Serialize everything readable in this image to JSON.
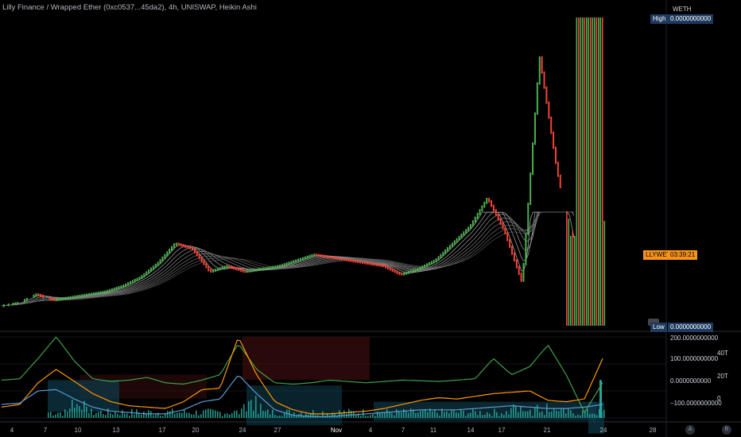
{
  "header": {
    "title": "Lilly Finance / Wrapped Ether (0xc0537...45da2), 4h, UNISWAP, Heikin Ashi"
  },
  "price_axis": {
    "currency": "WETH",
    "high_label": "High",
    "high_value": "0.0000000000",
    "low_label": "Low",
    "low_value": "0.0000000000",
    "symbol_tag": "LLYWETH",
    "countdown": "03:39:21"
  },
  "oscillator_axis": {
    "labels": [
      "200.0000000000",
      "100.0000000000",
      "0.0000000000",
      "−100.0000000000"
    ],
    "volume_labels": [
      "40T",
      "20T",
      "0"
    ]
  },
  "time_axis": {
    "ticks": [
      "4",
      "7",
      "10",
      "13",
      "17",
      "20",
      "24",
      "27",
      "Nov",
      "4",
      "7",
      "11",
      "14",
      "17",
      "21",
      "24",
      "28"
    ],
    "highlight": "Nov"
  },
  "footer_buttons": {
    "auto": "A",
    "log": "B"
  },
  "colors": {
    "bull": "#4caf50",
    "bear": "#f44336",
    "orange": "#ff9800",
    "tag_dark": "#1e3a5f",
    "green_line": "#43a047",
    "red_line": "#e53935",
    "blue_line": "#5b9bd5",
    "histogram": "#26a69a"
  },
  "chart_data": [
    {
      "type": "candlestick",
      "style": "Heikin Ashi",
      "interval": "4h",
      "exchange": "UNISWAP",
      "x_labels": [
        "4",
        "7",
        "10",
        "13",
        "17",
        "20",
        "24",
        "27",
        "Nov",
        "4",
        "7",
        "11",
        "14",
        "17",
        "21",
        "24",
        "28"
      ],
      "price_trend_relative": [
        0.02,
        0.03,
        0.06,
        0.04,
        0.05,
        0.06,
        0.07,
        0.09,
        0.12,
        0.17,
        0.24,
        0.22,
        0.14,
        0.16,
        0.14,
        0.15,
        0.16,
        0.18,
        0.2,
        0.19,
        0.18,
        0.17,
        0.16,
        0.13,
        0.15,
        0.18,
        0.24,
        0.3,
        0.4,
        0.28,
        0.1,
        0.9,
        0.5,
        0.2
      ]
    },
    {
      "type": "line",
      "name": "oscillator",
      "ylim": [
        -100,
        200
      ],
      "series": [
        {
          "color": "#43a047",
          "values": [
            40,
            45,
            120,
            200,
            110,
            45,
            35,
            40,
            50,
            30,
            25,
            40,
            60,
            175,
            80,
            30,
            25,
            30,
            40,
            35,
            30,
            35,
            40,
            38,
            35,
            40,
            45,
            120,
            60,
            90,
            170,
            60,
            -80,
            30
          ]
        },
        {
          "color": "#ff9800",
          "values": [
            -60,
            -50,
            30,
            80,
            35,
            -10,
            -40,
            -55,
            -60,
            -65,
            -40,
            5,
            10,
            200,
            60,
            -40,
            -70,
            -85,
            -85,
            -80,
            -75,
            -65,
            -50,
            -35,
            -25,
            -30,
            -20,
            -10,
            -5,
            0,
            -35,
            -40,
            -30,
            120
          ]
        },
        {
          "color": "#5b9bd5",
          "values": [
            -50,
            -45,
            0,
            5,
            -30,
            -60,
            -75,
            -80,
            -85,
            -85,
            -70,
            -40,
            -30,
            60,
            -10,
            -70,
            -90,
            -95,
            -95,
            -90,
            -85,
            -80,
            -75,
            -70,
            -70,
            -70,
            -65,
            -60,
            -55,
            -60,
            -65,
            -65,
            -60,
            -50
          ]
        }
      ]
    }
  ]
}
